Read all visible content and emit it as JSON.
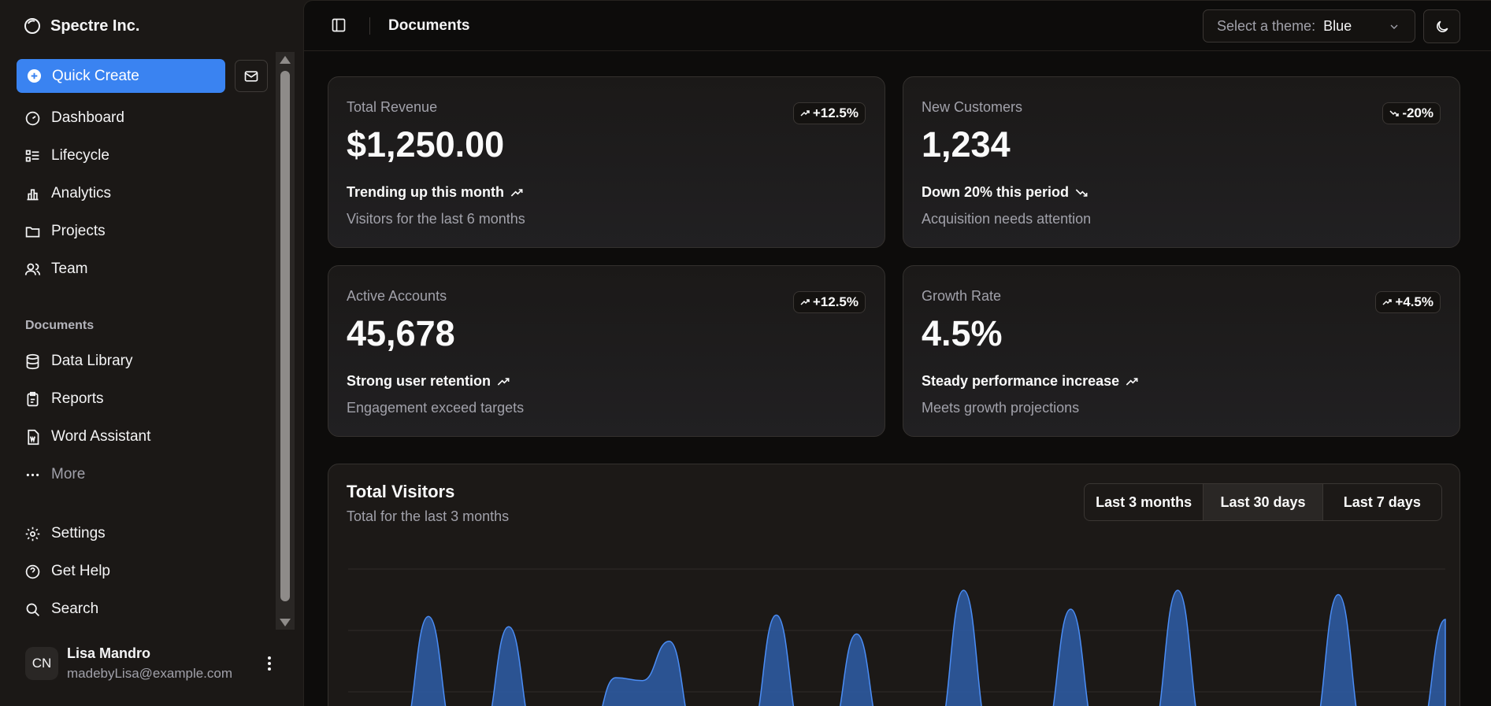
{
  "brand": {
    "name": "Spectre Inc."
  },
  "sidebar": {
    "quick_create": "Quick Create",
    "main_nav": [
      {
        "label": "Dashboard",
        "icon": "gauge-icon"
      },
      {
        "label": "Lifecycle",
        "icon": "list-icon"
      },
      {
        "label": "Analytics",
        "icon": "bar-chart-icon"
      },
      {
        "label": "Projects",
        "icon": "folder-icon"
      },
      {
        "label": "Team",
        "icon": "users-icon"
      }
    ],
    "documents_label": "Documents",
    "documents_nav": [
      {
        "label": "Data Library",
        "icon": "database-icon"
      },
      {
        "label": "Reports",
        "icon": "clipboard-icon"
      },
      {
        "label": "Word Assistant",
        "icon": "word-file-icon"
      },
      {
        "label": "More",
        "icon": "ellipsis-icon"
      }
    ],
    "secondary_nav": [
      {
        "label": "Settings",
        "icon": "gear-icon"
      },
      {
        "label": "Get Help",
        "icon": "help-circle-icon"
      },
      {
        "label": "Search",
        "icon": "search-icon"
      }
    ],
    "user": {
      "initials": "CN",
      "name": "Lisa Mandro",
      "email": "madebyLisa@example.com"
    }
  },
  "header": {
    "title": "Documents",
    "theme_label": "Select a theme:",
    "theme_value": "Blue"
  },
  "cards": [
    {
      "title": "Total Revenue",
      "value": "$1,250.00",
      "badge": "+12.5%",
      "trend": "up",
      "note": "Trending up this month",
      "desc": "Visitors for the last 6 months"
    },
    {
      "title": "New Customers",
      "value": "1,234",
      "badge": "-20%",
      "trend": "down",
      "note": "Down 20% this period",
      "desc": "Acquisition needs attention"
    },
    {
      "title": "Active Accounts",
      "value": "45,678",
      "badge": "+12.5%",
      "trend": "up",
      "note": "Strong user retention",
      "desc": "Engagement exceed targets"
    },
    {
      "title": "Growth Rate",
      "value": "4.5%",
      "badge": "+4.5%",
      "trend": "up",
      "note": "Steady performance increase",
      "desc": "Meets growth projections"
    }
  ],
  "visitors": {
    "title": "Total Visitors",
    "subtitle": "Total for the last 3 months",
    "ranges": [
      "Last 3 months",
      "Last 30 days",
      "Last 7 days"
    ],
    "active_range": "Last 30 days"
  },
  "colors": {
    "accent": "#3a83f1",
    "area_fill": "#2e5ea8",
    "area_stroke": "#4b8df5"
  },
  "chart_data": {
    "type": "area",
    "title": "Total Visitors",
    "grid": true,
    "series": [
      {
        "values": [
          0,
          0,
          0,
          82,
          0,
          0,
          75,
          0,
          0,
          0,
          40,
          38,
          65,
          0,
          0,
          0,
          83,
          0,
          0,
          70,
          0,
          15,
          0,
          100,
          0,
          0,
          0,
          87,
          0,
          0,
          0,
          100,
          0,
          0,
          0,
          0,
          0,
          97,
          0,
          0,
          0,
          80
        ]
      }
    ]
  }
}
